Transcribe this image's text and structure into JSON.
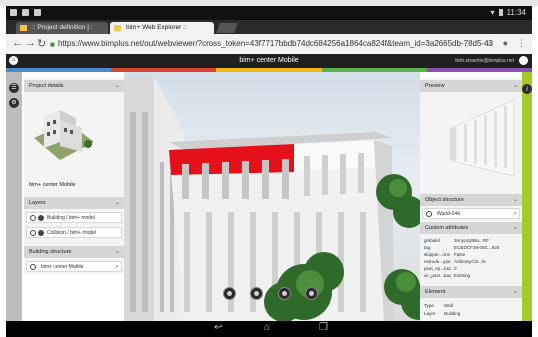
{
  "status_bar": {
    "time": "11:34"
  },
  "browser": {
    "tabs": [
      {
        "label": ":: Project definition | :"
      },
      {
        "label": "bim+ Web Explorer ::"
      }
    ],
    "url": "https://www.bimplus.net/out/webviewer/?cross_token=43f7717bbdb74dc684256a1864ca824f&team_id=3a2665db-78d5-43"
  },
  "app": {
    "title": "bim+ center Mobile",
    "user": "felix.straehle@bimplus.net"
  },
  "colors": {
    "strip": [
      "#4a8bd0",
      "#d8452f",
      "#f2b81a",
      "#59b24a",
      "#8a4fb0"
    ],
    "right_rail": "#a4c92a",
    "building_red": "#e6101a"
  },
  "left_panel": {
    "project_details": {
      "header": "Project details",
      "project_name": "bim+ center Mobile"
    },
    "layers": {
      "header": "Layers",
      "items": [
        {
          "label": "Building / bim+ model"
        },
        {
          "label": "Collision / bim+ model"
        }
      ]
    },
    "building_structure": {
      "header": "Building structure",
      "items": [
        {
          "label": "bim+ center Mobile"
        }
      ]
    }
  },
  "right_panel": {
    "preview": {
      "header": "Preview"
    },
    "object_structure": {
      "header": "Object structure",
      "item": "Wand-044"
    },
    "custom_attributes": {
      "header": "Custom attributes",
      "rows": [
        {
          "key": "globalid",
          "value": "3nnyo2y59u...RF"
        },
        {
          "key": "tag",
          "value": "ECBDCF38-08C...925"
        },
        {
          "key": "skipper...ons",
          "value": "False"
        },
        {
          "key": "extrude...ype",
          "value": "ArbitraryClo...le"
        },
        {
          "key": "pset_ep...bsc",
          "value": "0"
        },
        {
          "key": "ac_pset...bac",
          "value": "Existing"
        }
      ]
    },
    "element": {
      "header": "Element",
      "rows": [
        {
          "key": "Type",
          "value": "Wall"
        },
        {
          "key": "Layer",
          "value": "Building"
        }
      ]
    }
  },
  "viewer_tools": [
    {
      "icon": "rotate-icon"
    },
    {
      "icon": "pan-icon"
    },
    {
      "icon": "zoom-icon"
    },
    {
      "icon": "reset-view-icon"
    }
  ]
}
